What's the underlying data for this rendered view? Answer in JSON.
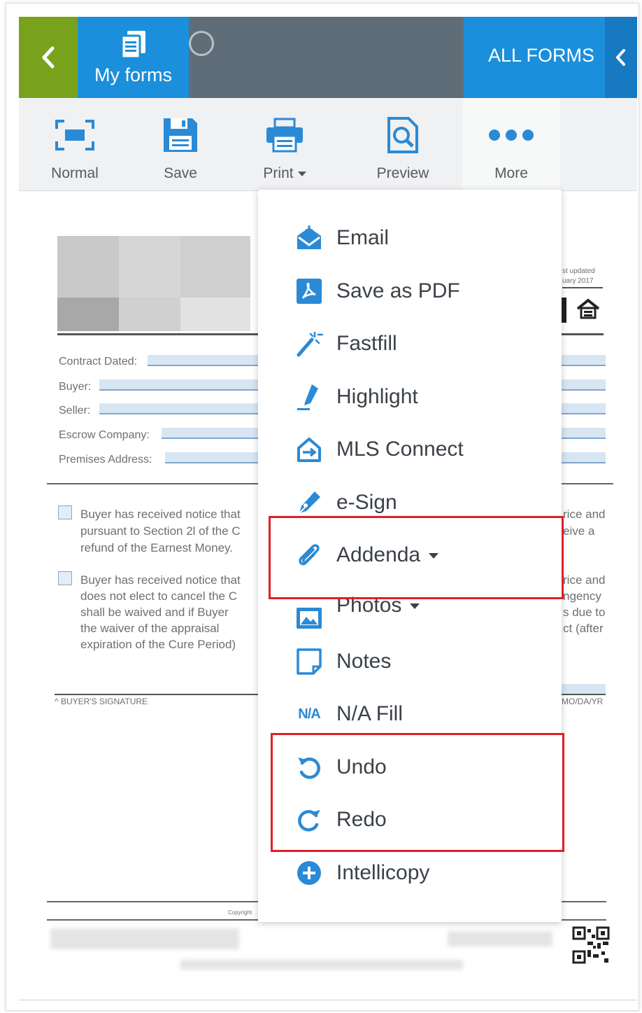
{
  "header": {
    "my_forms_label": "My forms",
    "all_forms_label": "ALL FORMS"
  },
  "toolbar": {
    "normal_label": "Normal",
    "save_label": "Save",
    "print_label": "Print",
    "preview_label": "Preview",
    "more_label": "More"
  },
  "document": {
    "contract_dated_label": "Contract Dated:",
    "buyer_label": "Buyer:",
    "seller_label": "Seller:",
    "escrow_label": "Escrow Company:",
    "premises_label": "Premises Address:",
    "date_updated": "st updated",
    "date_month": "uary 2017",
    "para1_line1": "Buyer has received notice that",
    "para1_line2": "pursuant to Section 2l of the C",
    "para1_line3": "refund of the Earnest Money.",
    "para1_right1": "rice and",
    "para1_right2": "eive a",
    "para2_line1": "Buyer has received notice that",
    "para2_line2": "does not elect to cancel the C",
    "para2_line3": "shall be waived and if Buyer",
    "para2_line4": "the  waiver  of  the  appraisal",
    "para2_line5": "expiration of the Cure Period)",
    "para2_right1": "rice and",
    "para2_right2": "ngency",
    "para2_right3": "s due to",
    "para2_right4": "ct  (after",
    "buyer_signature": "^ BUYER'S SIGNATURE",
    "date_format": "MO/DA/YR",
    "copyright": "Copyright"
  },
  "more_menu": {
    "items": [
      {
        "label": "Email",
        "icon": "email-icon"
      },
      {
        "label": "Save as PDF",
        "icon": "pdf-icon"
      },
      {
        "label": "Fastfill",
        "icon": "magic-wand-icon"
      },
      {
        "label": "Highlight",
        "icon": "highlighter-icon"
      },
      {
        "label": "MLS Connect",
        "icon": "mls-connect-icon"
      },
      {
        "label": "e-Sign",
        "icon": "pen-icon"
      },
      {
        "label": "Addenda",
        "icon": "paperclip-icon",
        "dropdown": true
      },
      {
        "label": "Photos",
        "icon": "photo-icon",
        "dropdown": true
      },
      {
        "label": "Notes",
        "icon": "note-icon"
      },
      {
        "label": "N/A Fill",
        "icon": "na-icon",
        "icon_text": "N/A"
      },
      {
        "label": "Undo",
        "icon": "undo-icon"
      },
      {
        "label": "Redo",
        "icon": "redo-icon"
      },
      {
        "label": "Intellicopy",
        "icon": "plus-circle-icon"
      }
    ]
  },
  "colors": {
    "accent_blue": "#1b8fdb",
    "back_green": "#78a21c",
    "header_gray": "#5f6d79",
    "highlight_red": "#e02027",
    "icon_blue": "#2a8ad6"
  }
}
